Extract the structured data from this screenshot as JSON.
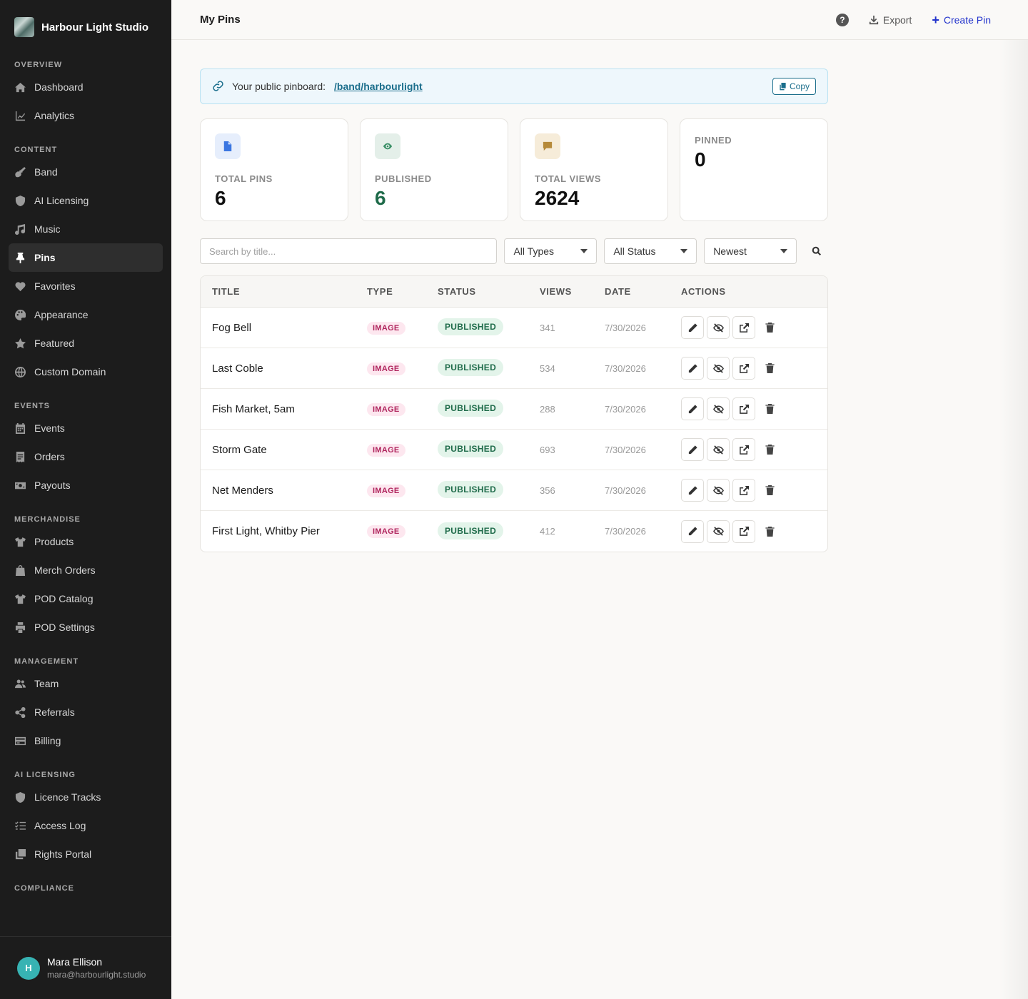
{
  "app": {
    "name": "Harbour Light Studio"
  },
  "sidebar": {
    "sections": [
      {
        "label": "OVERVIEW",
        "items": [
          {
            "label": "Dashboard",
            "icon": "home-icon"
          },
          {
            "label": "Analytics",
            "icon": "chart-line-icon"
          }
        ]
      },
      {
        "label": "CONTENT",
        "items": [
          {
            "label": "Band",
            "icon": "guitar-icon"
          },
          {
            "label": "AI Licensing",
            "icon": "shield-icon"
          },
          {
            "label": "Music",
            "icon": "music-note-icon"
          },
          {
            "label": "Pins",
            "icon": "thumbtack-icon",
            "active": true
          },
          {
            "label": "Favorites",
            "icon": "heart-icon"
          },
          {
            "label": "Appearance",
            "icon": "palette-icon"
          },
          {
            "label": "Featured",
            "icon": "star-icon"
          },
          {
            "label": "Custom Domain",
            "icon": "globe-icon"
          }
        ]
      },
      {
        "label": "EVENTS",
        "items": [
          {
            "label": "Events",
            "icon": "calendar-icon"
          },
          {
            "label": "Orders",
            "icon": "receipt-icon"
          },
          {
            "label": "Payouts",
            "icon": "money-icon"
          }
        ]
      },
      {
        "label": "MERCHANDISE",
        "items": [
          {
            "label": "Products",
            "icon": "tshirt-icon"
          },
          {
            "label": "Merch Orders",
            "icon": "bag-icon"
          },
          {
            "label": "POD Catalog",
            "icon": "tshirt-icon"
          },
          {
            "label": "POD Settings",
            "icon": "printer-icon"
          }
        ]
      },
      {
        "label": "MANAGEMENT",
        "items": [
          {
            "label": "Team",
            "icon": "users-icon"
          },
          {
            "label": "Referrals",
            "icon": "share-icon"
          },
          {
            "label": "Billing",
            "icon": "credit-card-icon"
          }
        ]
      },
      {
        "label": "AI LICENSING",
        "items": [
          {
            "label": "Licence Tracks",
            "icon": "shield-icon"
          },
          {
            "label": "Access Log",
            "icon": "list-check-icon"
          },
          {
            "label": "Rights Portal",
            "icon": "copy-icon"
          }
        ]
      },
      {
        "label": "COMPLIANCE",
        "items": []
      }
    ]
  },
  "user": {
    "initial": "H",
    "name": "Mara Ellison",
    "email": "mara@harbourlight.studio",
    "avatar_color": "#37b3b3"
  },
  "header": {
    "title": "My Pins",
    "export_label": "Export",
    "create_label": "Create Pin"
  },
  "banner": {
    "label": "Your public pinboard:",
    "link": "/band/harbourlight",
    "copy_label": "Copy"
  },
  "stats": [
    {
      "label": "TOTAL PINS",
      "value": "6",
      "icon": "file-icon",
      "icon_bg": "#e6eefc",
      "icon_color": "#3b76e1"
    },
    {
      "label": "PUBLISHED",
      "value": "6",
      "icon": "eye-icon",
      "icon_bg": "#e4efe9",
      "icon_color": "#3a8f66"
    },
    {
      "label": "TOTAL VIEWS",
      "value": "2624",
      "icon": "comment-icon",
      "icon_bg": "#f6ecd9",
      "icon_color": "#b68a3a"
    },
    {
      "label": "PINNED",
      "value": "0"
    }
  ],
  "filters": {
    "search_placeholder": "Search by title...",
    "type": "All Types",
    "status": "All Status",
    "sort": "Newest"
  },
  "table": {
    "columns": [
      "TITLE",
      "TYPE",
      "STATUS",
      "VIEWS",
      "DATE",
      "ACTIONS"
    ],
    "rows": [
      {
        "title": "Fog Bell",
        "type": "IMAGE",
        "status": "PUBLISHED",
        "views": "341",
        "date": "7/30/2026"
      },
      {
        "title": "Last Coble",
        "type": "IMAGE",
        "status": "PUBLISHED",
        "views": "534",
        "date": "7/30/2026"
      },
      {
        "title": "Fish Market, 5am",
        "type": "IMAGE",
        "status": "PUBLISHED",
        "views": "288",
        "date": "7/30/2026"
      },
      {
        "title": "Storm Gate",
        "type": "IMAGE",
        "status": "PUBLISHED",
        "views": "693",
        "date": "7/30/2026"
      },
      {
        "title": "Net Menders",
        "type": "IMAGE",
        "status": "PUBLISHED",
        "views": "356",
        "date": "7/30/2026"
      },
      {
        "title": "First Light, Whitby Pier",
        "type": "IMAGE",
        "status": "PUBLISHED",
        "views": "412",
        "date": "7/30/2026"
      }
    ]
  },
  "colors": {
    "accent": "#2233cc",
    "link": "#1b6e8c",
    "published": "#1f6b4a",
    "image_badge": "#b0265e"
  }
}
